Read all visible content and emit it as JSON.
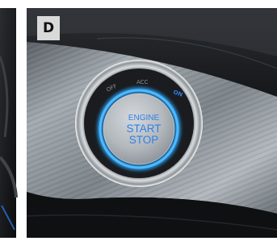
{
  "panel_label": "D",
  "ignition": {
    "positions": {
      "off": "OFF",
      "acc": "ACC",
      "on": "ON"
    },
    "button_lines": [
      "ENGINE",
      "START",
      "STOP"
    ]
  },
  "colors": {
    "frame": "#ffffff",
    "trim_dark": "#16181b",
    "trim_metal": "#8f969c",
    "glow_blue": "#29a8ff",
    "button_face": "#b9bec3",
    "label_blue": "#2f7fe8",
    "label_gray": "#8a8f95"
  }
}
